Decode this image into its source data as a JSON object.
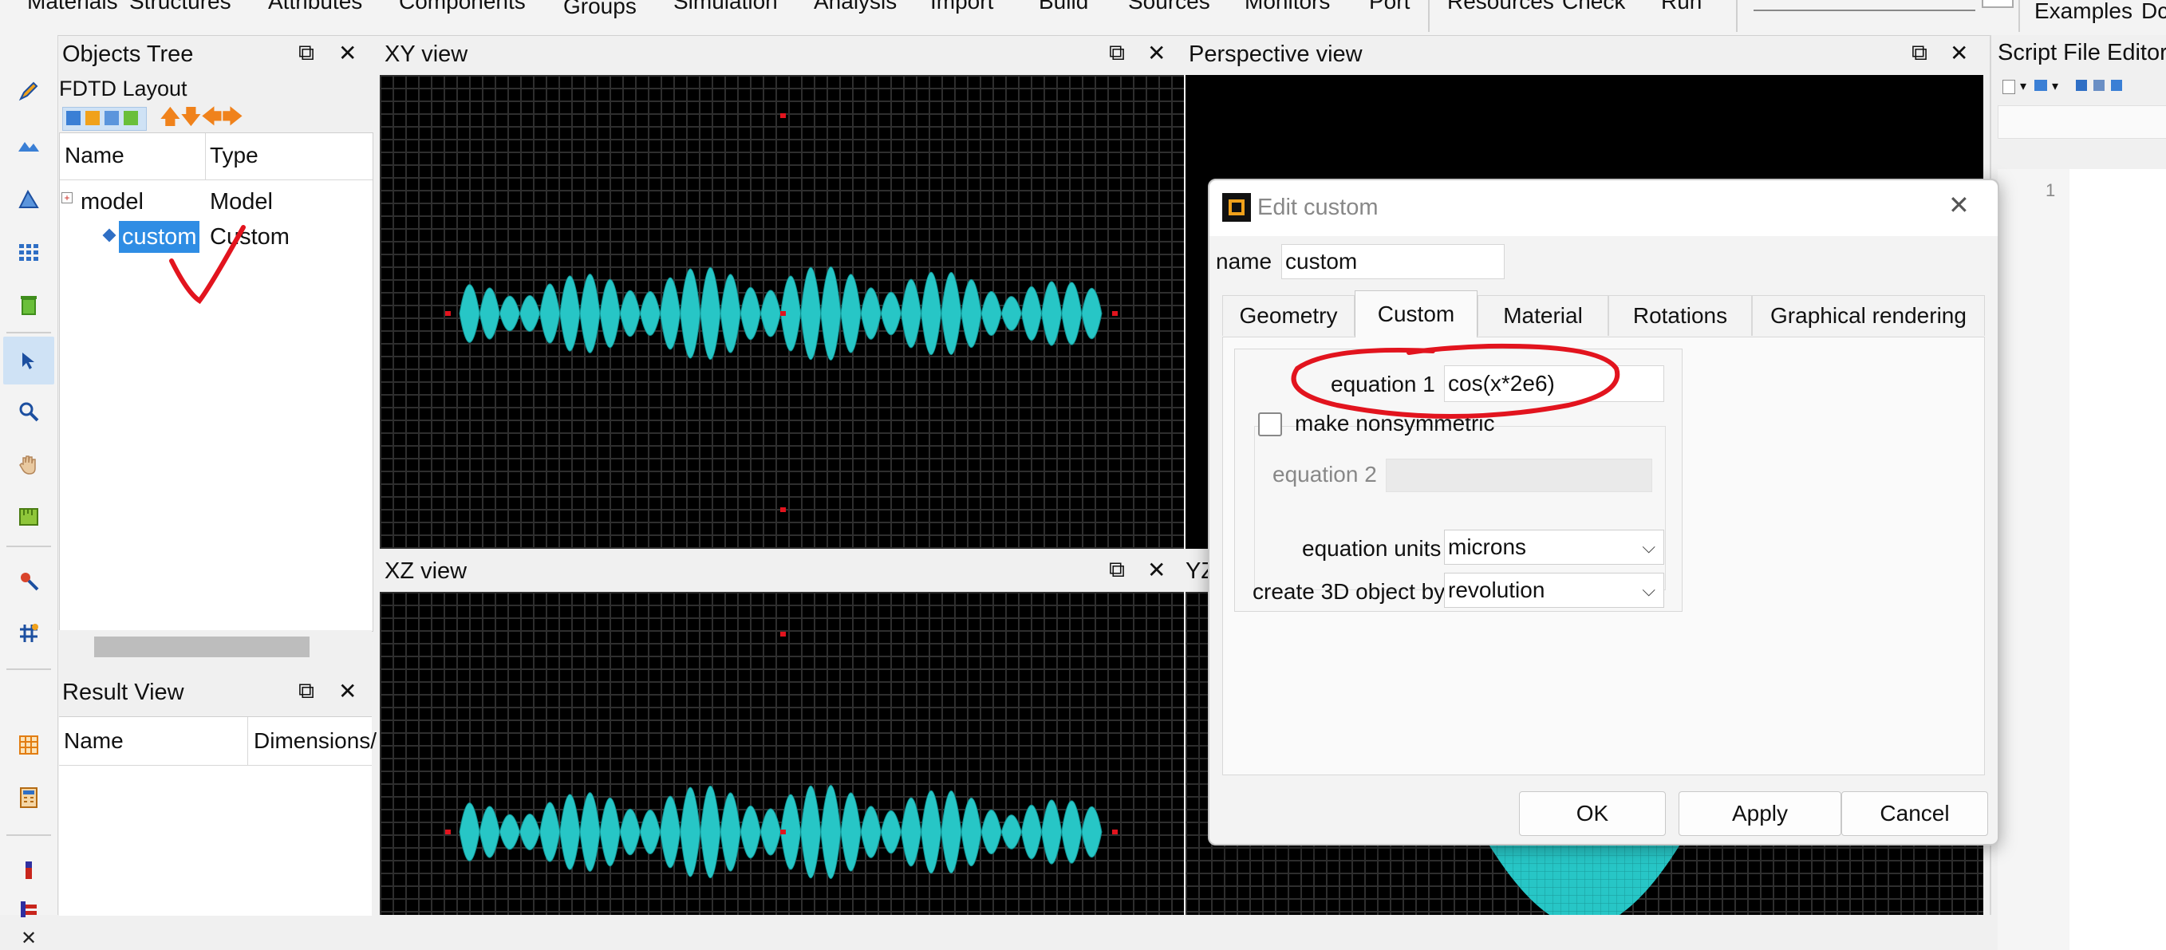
{
  "menu": {
    "items": [
      "Materials",
      "Structures",
      "Attributes",
      "Components",
      "Groups",
      "Simulation",
      "Analysis",
      "Import",
      "Build",
      "Sources",
      "Monitors",
      "Port",
      "Resources",
      "Check",
      "Run"
    ],
    "right_items": [
      "Examples",
      "Dc"
    ]
  },
  "objects_tree": {
    "title": "Objects Tree",
    "subtitle": "FDTD Layout",
    "columns": [
      "Name",
      "Type"
    ],
    "rows": [
      {
        "name": "model",
        "type": "Model"
      },
      {
        "name": "custom",
        "type": "Custom"
      }
    ]
  },
  "result_view": {
    "title": "Result View",
    "columns": [
      "Name",
      "Dimensions/"
    ]
  },
  "viewports": {
    "xy_title": "XY view",
    "xz_title": "XZ view",
    "perspective_title": "Perspective view",
    "yz_title_partial": "YZ"
  },
  "script_editor": {
    "title": "Script File Editor",
    "line_number": "1"
  },
  "dialog": {
    "title": "Edit custom",
    "name_label": "name",
    "name_value": "custom",
    "tabs": [
      "Geometry",
      "Custom",
      "Material",
      "Rotations",
      "Graphical rendering"
    ],
    "active_tab": "Custom",
    "equation1_label": "equation 1",
    "equation1_value": "cos(x*2e6)",
    "nonsymmetric_label": "make nonsymmetric",
    "nonsymmetric_checked": false,
    "equation2_label": "equation 2",
    "equation2_value": "",
    "units_label": "equation units",
    "units_value": "microns",
    "create_label": "create 3D object by",
    "create_value": "revolution",
    "buttons": {
      "ok": "OK",
      "apply": "Apply",
      "cancel": "Cancel"
    }
  },
  "colors": {
    "structure": "#27c6c6",
    "selection": "#2f8de4",
    "annotation": "#e2141e",
    "grid": "#2e2e2e"
  }
}
